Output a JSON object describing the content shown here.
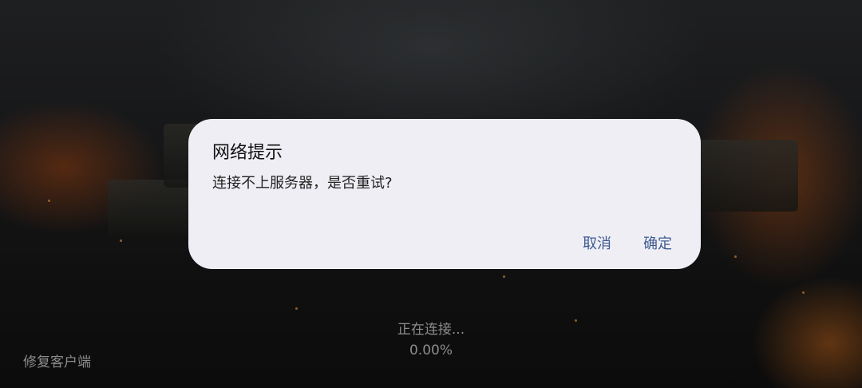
{
  "dialog": {
    "title": "网络提示",
    "message": "连接不上服务器，是否重试?",
    "cancel_label": "取消",
    "confirm_label": "确定",
    "background_color": "#efeef4",
    "button_color": "#3e5a92"
  },
  "loading": {
    "status": "正在连接...",
    "progress_text": "0.00%",
    "progress": 0
  },
  "footer": {
    "repair_label": "修复客户端"
  }
}
